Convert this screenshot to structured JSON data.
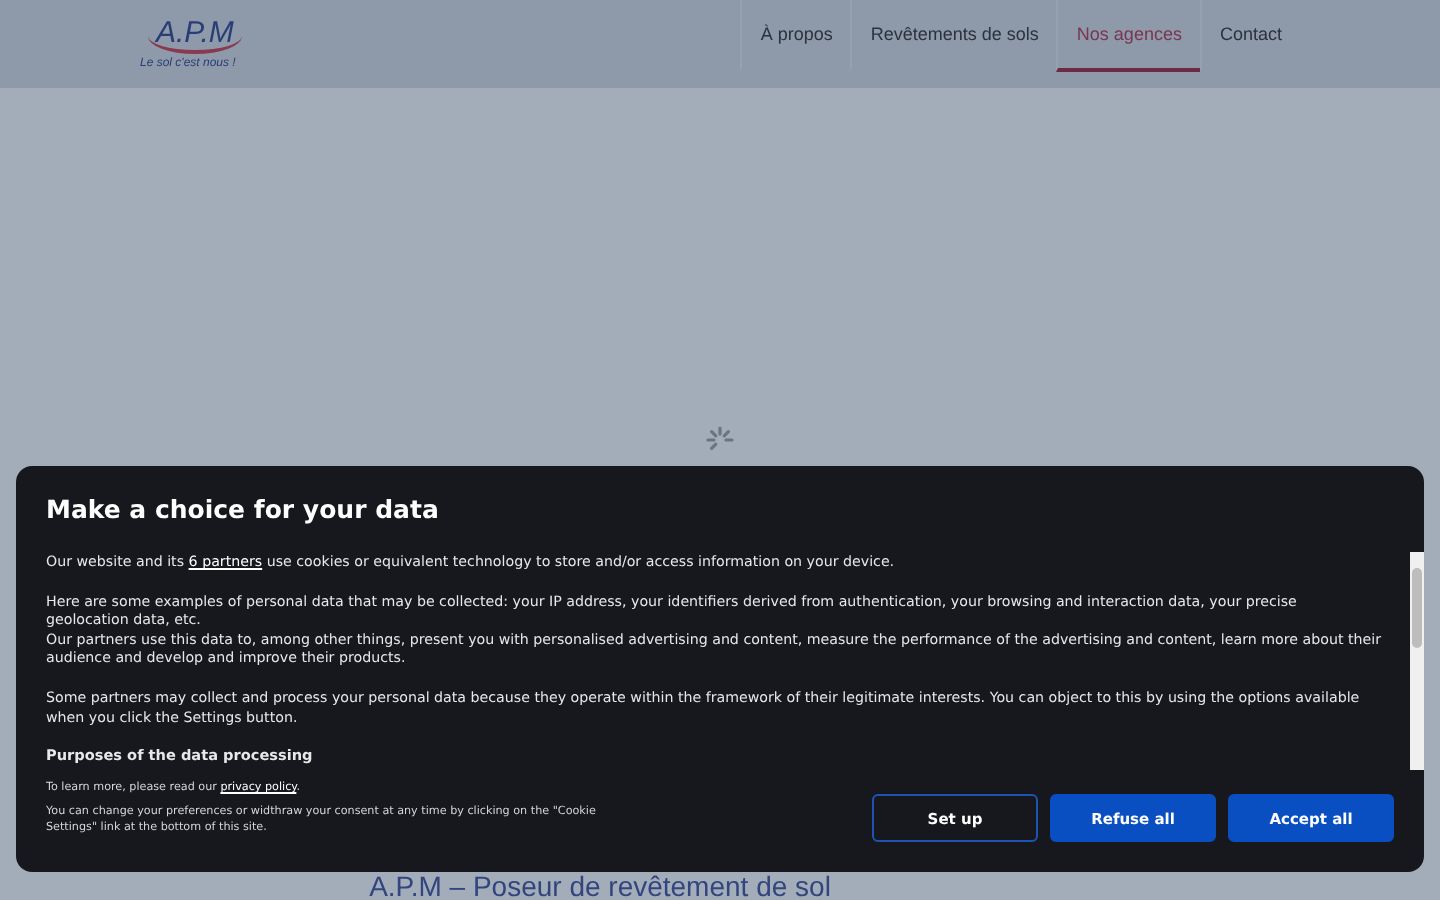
{
  "header": {
    "logo": "A.P.M",
    "tagline": "Le sol c'est nous !",
    "nav": [
      {
        "label": "À propos",
        "selected": false
      },
      {
        "label": "Revêtements de sols",
        "selected": false
      },
      {
        "label": "Nos agences",
        "selected": true
      },
      {
        "label": "Contact",
        "selected": false
      }
    ]
  },
  "page_heading": "A.P.M – Poseur de revêtement de sol",
  "consent": {
    "title": "Make a choice for your data",
    "intro": {
      "before": "Our website and its",
      "link": "6 partners",
      "after": "use cookies or equivalent technology to store and/or access information on your device."
    },
    "paragraphs": [
      "Here are some examples of personal data that may be collected: your IP address, your identifiers derived from authentication, your browsing and interaction data, your precise geolocation data, etc.",
      "Our partners use this data to, among other things, present you with personalised advertising and content, measure the performance of the advertising and content, learn more about their audience and develop and improve their products.",
      "Some partners may collect and process your personal data because they operate within the framework of their legitimate interests. You can object to this by using the options available when you click the Settings button."
    ],
    "section_title": "Purposes of the data processing",
    "learn_more": {
      "before": "To learn more, please read our",
      "link": "privacy policy",
      "after": "."
    },
    "note": "You can change your preferences or widthraw your consent at any time by clicking on the \"Cookie Settings\" link at the bottom of this site.",
    "buttons": [
      {
        "label": "Set up",
        "kind": "outline"
      },
      {
        "label": "Refuse all",
        "kind": "filled"
      },
      {
        "label": "Accept all",
        "kind": "filled"
      }
    ]
  }
}
